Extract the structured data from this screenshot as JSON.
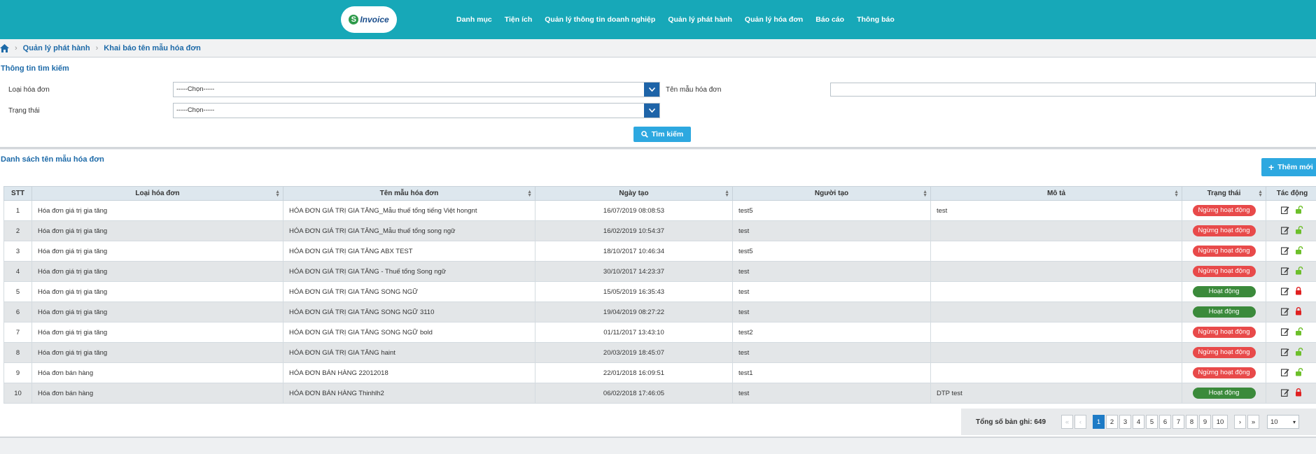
{
  "header": {
    "logo_text": "Invoice",
    "nav": [
      "Danh mục",
      "Tiện ích",
      "Quản lý thông tin doanh nghiệp",
      "Quản lý phát hành",
      "Quản lý hóa đơn",
      "Báo cáo",
      "Thông báo"
    ]
  },
  "breadcrumb": [
    "Quản lý phát hành",
    "Khai báo tên mẫu hóa đơn"
  ],
  "search": {
    "title": "Thông tin tìm kiếm",
    "invoice_type_label": "Loại hóa đơn",
    "invoice_type_value": "-----Chọn-----",
    "status_label": "Trạng thái",
    "status_value": "-----Chọn-----",
    "template_name_label": "Tên mẫu hóa đơn",
    "template_name_value": "",
    "search_button": "Tìm kiếm"
  },
  "list": {
    "title": "Danh sách tên mẫu hóa đơn",
    "add_button": "Thêm mới",
    "columns": [
      "STT",
      "Loại hóa đơn",
      "Tên mẫu hóa đơn",
      "Ngày tạo",
      "Người tạo",
      "Mô tả",
      "Trạng thái",
      "Tác động"
    ],
    "rows": [
      {
        "stt": "1",
        "type": "Hóa đơn giá trị gia tăng",
        "name": "HÓA ĐƠN GIÁ TRỊ GIA TĂNG_Mẫu thuế tổng tiếng Việt hongnt",
        "created": "16/07/2019 08:08:53",
        "creator": "test5",
        "desc": "test",
        "status": "Ngừng hoạt động",
        "active": false
      },
      {
        "stt": "2",
        "type": "Hóa đơn giá trị gia tăng",
        "name": "HÓA ĐƠN GIÁ TRỊ GIA TĂNG_Mẫu thuế tổng song ngữ",
        "created": "16/02/2019 10:54:37",
        "creator": "test",
        "desc": "",
        "status": "Ngừng hoạt động",
        "active": false
      },
      {
        "stt": "3",
        "type": "Hóa đơn giá trị gia tăng",
        "name": "HÓA ĐƠN GIÁ TRỊ GIA TĂNG ABX TEST",
        "created": "18/10/2017 10:46:34",
        "creator": "test5",
        "desc": "",
        "status": "Ngừng hoạt động",
        "active": false
      },
      {
        "stt": "4",
        "type": "Hóa đơn giá trị gia tăng",
        "name": "HÓA ĐƠN GIÁ TRỊ GIA TĂNG - Thuế tổng Song ngữ",
        "created": "30/10/2017 14:23:37",
        "creator": "test",
        "desc": "",
        "status": "Ngừng hoạt động",
        "active": false
      },
      {
        "stt": "5",
        "type": "Hóa đơn giá trị gia tăng",
        "name": "HÓA ĐƠN GIÁ TRỊ GIA TĂNG SONG NGỮ",
        "created": "15/05/2019 16:35:43",
        "creator": "test",
        "desc": "",
        "status": "Hoạt động",
        "active": true
      },
      {
        "stt": "6",
        "type": "Hóa đơn giá trị gia tăng",
        "name": "HÓA ĐƠN GIÁ TRỊ GIA TĂNG SONG NGỮ 3110",
        "created": "19/04/2019 08:27:22",
        "creator": "test",
        "desc": "",
        "status": "Hoạt động",
        "active": true
      },
      {
        "stt": "7",
        "type": "Hóa đơn giá trị gia tăng",
        "name": "HÓA ĐƠN GIÁ TRỊ GIA TĂNG SONG NGỮ bold",
        "created": "01/11/2017 13:43:10",
        "creator": "test2",
        "desc": "",
        "status": "Ngừng hoạt động",
        "active": false
      },
      {
        "stt": "8",
        "type": "Hóa đơn giá trị gia tăng",
        "name": "HÓA ĐƠN GIÁ TRỊ GIA TĂNG haint",
        "created": "20/03/2019 18:45:07",
        "creator": "test",
        "desc": "",
        "status": "Ngừng hoạt động",
        "active": false
      },
      {
        "stt": "9",
        "type": "Hóa đơn bán hàng",
        "name": "HÓA ĐƠN BÁN HÀNG 22012018",
        "created": "22/01/2018 16:09:51",
        "creator": "test1",
        "desc": "",
        "status": "Ngừng hoạt động",
        "active": false
      },
      {
        "stt": "10",
        "type": "Hóa đơn bán hàng",
        "name": "HÓA ĐƠN BÁN HÀNG Thinhlh2",
        "created": "06/02/2018 17:46:05",
        "creator": "test",
        "desc": "DTP test",
        "status": "Hoạt động",
        "active": true
      }
    ]
  },
  "pagination": {
    "total_label": "Tổng số bản ghi: 649",
    "pages": [
      "1",
      "2",
      "3",
      "4",
      "5",
      "6",
      "7",
      "8",
      "9",
      "10"
    ],
    "current": "1",
    "page_size": "10"
  },
  "colors": {
    "header": "#17a8b8",
    "primary": "#2da8e0",
    "danger": "#e84a4a",
    "success": "#3b8a3b"
  }
}
